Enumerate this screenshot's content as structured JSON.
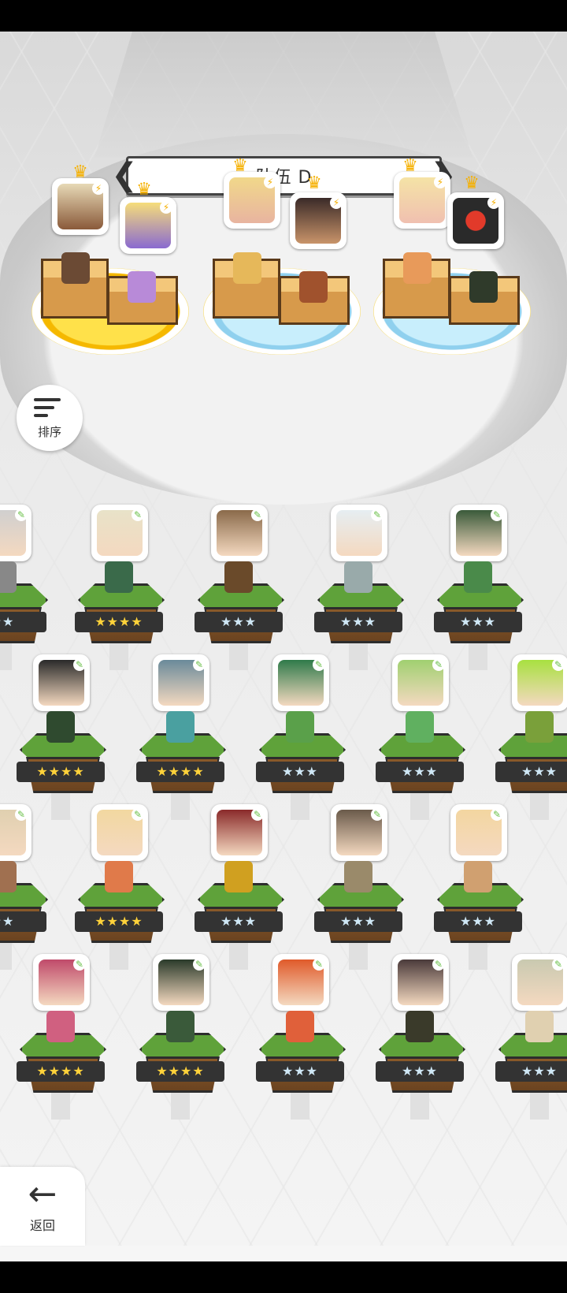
{
  "team": {
    "title": "队伍 D",
    "prev_arrow": "❮",
    "next_arrow": "❯"
  },
  "buttons": {
    "sort_label": "排序",
    "back_label": "返回",
    "back_arrow": "←"
  },
  "party_slots": [
    {
      "ring": "gold",
      "leader_crown": true,
      "members": [
        "face-1",
        "face-2"
      ]
    },
    {
      "ring": "blue",
      "leader_crown": true,
      "members": [
        "face-3",
        "face-4"
      ]
    },
    {
      "ring": "blue",
      "leader_crown": true,
      "members": [
        "face-5",
        "face-6"
      ]
    }
  ],
  "roster_rows": [
    {
      "row": 1,
      "stars": [
        "★★",
        "★★★★",
        "★★★",
        "★★★",
        "★★★"
      ]
    },
    {
      "row": 2,
      "stars": [
        "★★★★",
        "★★★★",
        "★★★",
        "★★★",
        "★★★"
      ]
    },
    {
      "row": 3,
      "stars": [
        "★★",
        "★★★★",
        "★★★",
        "★★★",
        "★★★"
      ]
    },
    {
      "row": 4,
      "stars": [
        "★★★★",
        "★★★★",
        "★★★",
        "★★★",
        "★★★"
      ]
    }
  ],
  "colors": {
    "gold_star": "#ffd23a",
    "silver_star": "#cfe7f5",
    "grass": "#5fa23a",
    "gold_ring": "#ffe14a",
    "blue_ring": "#c8eefc"
  },
  "icons": {
    "leaf_mark": "✎",
    "bolt_mark": "⚡",
    "crown": "♛"
  }
}
